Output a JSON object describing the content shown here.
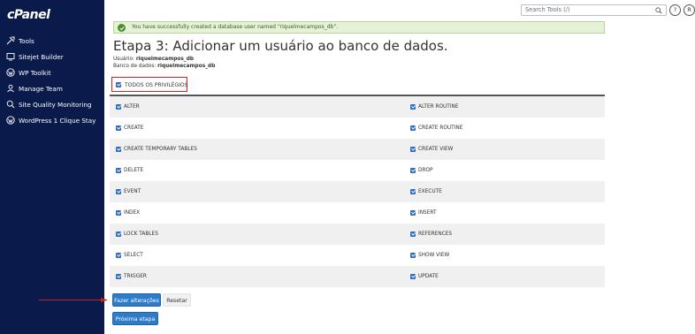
{
  "sidebar": {
    "logo": "cPanel",
    "items": [
      {
        "label": "Tools",
        "icon": "tools-icon"
      },
      {
        "label": "Sitejet Builder",
        "icon": "sitejet-icon"
      },
      {
        "label": "WP Toolkit",
        "icon": "wordpress-icon"
      },
      {
        "label": "Manage Team",
        "icon": "team-icon"
      },
      {
        "label": "Site Quality Monitoring",
        "icon": "site-quality-icon"
      },
      {
        "label": "WordPress 1 Clique Stay",
        "icon": "wordpress-icon"
      }
    ]
  },
  "topbar": {
    "search_placeholder": "Search Tools (/)",
    "search_icon": "search-icon",
    "help_icon": "help-icon",
    "user_icon": "user-icon",
    "user_letter": "R"
  },
  "banner": {
    "message": "You have successfully created a database user named “riquelmecampos_db”.",
    "status_color": "#4a8d2e"
  },
  "page": {
    "title": "Etapa 3: Adicionar um usuário ao banco de dados.",
    "user_label": "Usuário:",
    "user_value": "riquelmecampos_db",
    "db_label": "Banco de dados:",
    "db_value": "riquelmecampos_db"
  },
  "privileges": {
    "all_label": "TODOS OS PRIVILÉGIOS",
    "all_checked": true,
    "rows": [
      {
        "left": "ALTER",
        "right": "ALTER ROUTINE"
      },
      {
        "left": "CREATE",
        "right": "CREATE ROUTINE"
      },
      {
        "left": "CREATE TEMPORARY TABLES",
        "right": "CREATE VIEW"
      },
      {
        "left": "DELETE",
        "right": "DROP"
      },
      {
        "left": "EVENT",
        "right": "EXECUTE"
      },
      {
        "left": "INDEX",
        "right": "INSERT"
      },
      {
        "left": "LOCK TABLES",
        "right": "REFERENCES"
      },
      {
        "left": "SELECT",
        "right": "SHOW VIEW"
      },
      {
        "left": "TRIGGER",
        "right": "UPDATE"
      }
    ]
  },
  "actions": {
    "make_changes": "Fazer alterações",
    "reset": "Resetar",
    "next_step": "Próxima etapa"
  },
  "colors": {
    "sidebar": "#0a1a4a",
    "primary": "#2e7cc9",
    "highlight": "#e02020"
  }
}
